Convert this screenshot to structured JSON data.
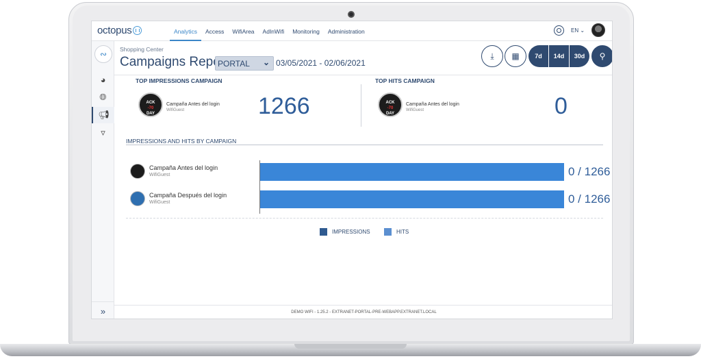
{
  "topbar": {
    "logo": "octopus",
    "nav": [
      "Analytics",
      "Access",
      "WifiArea",
      "AdInWifi",
      "Monitoring",
      "Administration"
    ],
    "active_nav": "Analytics",
    "language": "EN",
    "icons": {
      "settings": "gear-icon",
      "user": "avatar"
    }
  },
  "header": {
    "breadcrumb": "Shopping Center",
    "title": "Campaigns Report",
    "selector": {
      "selected": "PORTAL"
    },
    "date_range": "03/05/2021 - 02/06/2021",
    "buttons": {
      "download_icon": "download-icon",
      "calendar_icon": "calendar-icon",
      "d7": "7d",
      "d14": "14d",
      "d30": "30d",
      "search_icon": "search-icon"
    }
  },
  "top_impressions": {
    "heading": "TOP IMPRESSIONS CAMPAIGN",
    "campaign_name": "Campaña Antes del login",
    "campaign_sub": "WifiGuest",
    "value": "1266"
  },
  "top_hits": {
    "heading": "TOP HITS CAMPAIGN",
    "campaign_name": "Campaña Antes del login",
    "campaign_sub": "WifiGuest",
    "value": "0"
  },
  "campaign_image": {
    "line1": "ACK",
    "line2": "-70",
    "line3": "DAY"
  },
  "section": {
    "title": "IMPRESSIONS AND HITS BY CAMPAIGN"
  },
  "chart_data": {
    "type": "bar",
    "categories": [
      "Campaña Antes del login",
      "Campaña Después del login"
    ],
    "subtitles": [
      "WifiGuest",
      "WifiGuest"
    ],
    "series": [
      {
        "name": "IMPRESSIONS",
        "values": [
          1266,
          1266
        ],
        "color": "#3a86d8"
      },
      {
        "name": "HITS",
        "values": [
          0,
          0
        ],
        "color": "#5b8fd0"
      }
    ],
    "data_labels": [
      "0 / 1266",
      "0 / 1266"
    ],
    "legend": [
      {
        "label": "IMPRESSIONS",
        "color": "#2f5a90"
      },
      {
        "label": "HITS",
        "color": "#5b8fd0"
      }
    ],
    "legend_position": "bottom-center"
  },
  "footer": {
    "text": "DEMO WIFI - 1.25.2 - EXTRANET-PORTAL-PRE-WEBAPP.EXTRANET.LOCAL"
  }
}
